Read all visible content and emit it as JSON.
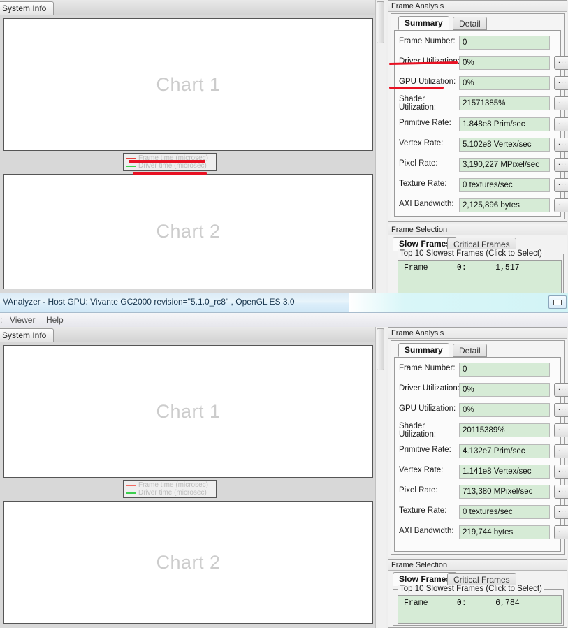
{
  "window": {
    "title": "VAnalyzer - Host GPU: Vivante GC2000 revision=\"5.1.0_rc8\" , OpenGL ES 3.0",
    "restore_button": "restore-window"
  },
  "menu": {
    "items": [
      {
        "label": ":",
        "x": 0
      },
      {
        "label": "Viewer",
        "x": 14
      },
      {
        "label": "Help",
        "x": 66
      }
    ]
  },
  "left_pane": {
    "tab_label": "System Info",
    "charts": [
      {
        "title": "Chart 1"
      },
      {
        "title": "Chart 2"
      }
    ],
    "legend": {
      "entries": [
        {
          "label": "Frame time (microsec)",
          "color": "#e8403a"
        },
        {
          "label": "Driver time (microsec)",
          "color": "#3ccf4e"
        }
      ]
    }
  },
  "frame_analysis": {
    "panel_title": "Frame Analysis",
    "tabs": [
      {
        "label": "Summary",
        "active": true
      },
      {
        "label": "Detail",
        "active": false
      }
    ],
    "more_button": "...",
    "top_window_fields": [
      {
        "label": "Frame Number:",
        "value": "0",
        "has_button": false
      },
      {
        "label": "Driver Utilization:",
        "value": "0%",
        "has_button": true
      },
      {
        "label": "GPU Utilization:",
        "value": "0%",
        "has_button": true
      },
      {
        "label": "Shader Utilization:",
        "value": "21571385%",
        "has_button": true,
        "two_line": true
      },
      {
        "label": "Primitive Rate:",
        "value": "1.848e8 Prim/sec",
        "has_button": true
      },
      {
        "label": "Vertex Rate:",
        "value": "5.102e8 Vertex/sec",
        "has_button": true
      },
      {
        "label": "Pixel Rate:",
        "value": "3,190,227 MPixel/sec",
        "has_button": true
      },
      {
        "label": "Texture Rate:",
        "value": "0 textures/sec",
        "has_button": true
      },
      {
        "label": "AXI Bandwidth:",
        "value": "2,125,896 bytes",
        "has_button": true
      }
    ],
    "bottom_window_fields": [
      {
        "label": "Frame Number:",
        "value": "0",
        "has_button": false
      },
      {
        "label": "Driver Utilization:",
        "value": "0%",
        "has_button": true
      },
      {
        "label": "GPU Utilization:",
        "value": "0%",
        "has_button": true
      },
      {
        "label": "Shader Utilization:",
        "value": "20115389%",
        "has_button": true,
        "two_line": true
      },
      {
        "label": "Primitive Rate:",
        "value": "4.132e7 Prim/sec",
        "has_button": true
      },
      {
        "label": "Vertex Rate:",
        "value": "1.141e8 Vertex/sec",
        "has_button": true
      },
      {
        "label": "Pixel Rate:",
        "value": "713,380 MPixel/sec",
        "has_button": true
      },
      {
        "label": "Texture Rate:",
        "value": "0 textures/sec",
        "has_button": true
      },
      {
        "label": "AXI Bandwidth:",
        "value": "219,744 bytes",
        "has_button": true
      }
    ]
  },
  "frame_selection": {
    "panel_title": "Frame Selection",
    "tabs": [
      {
        "label": "Slow Frames",
        "active": true
      },
      {
        "label": "Critical Frames",
        "active": false
      }
    ],
    "group_title": "Top 10 Slowest Frames (Click to Select)",
    "top_window_rows": [
      "Frame      0:      1,517"
    ],
    "bottom_window_rows": [
      "Frame      0:      6,784"
    ]
  },
  "shader_label_lines": {
    "line1": "Shader",
    "line2": "Utilization:"
  },
  "colors": {
    "field_green": "#d6ebd6",
    "annotation_red": "#e81123",
    "chart_text": "#cccccc",
    "legend_text": "#bdbdbd"
  }
}
